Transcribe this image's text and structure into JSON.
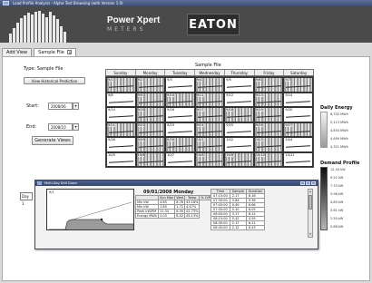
{
  "window": {
    "title": "Load Profile Analysis - Alpha Test Browsing (with Version 1.0)"
  },
  "banner": {
    "product_name": "Power Xpert",
    "product_sub": "METERS",
    "company": "EATON"
  },
  "tabs": [
    {
      "label": "Add View"
    },
    {
      "label": "Sample File",
      "close": "x"
    }
  ],
  "left_panel": {
    "type_label": "Type: Sample File",
    "view_historical_button": "View Historical Prediction",
    "start_label": "Start:",
    "start_value": "2008/06",
    "end_label": "End:",
    "end_value": "2008/10",
    "generate_button": "Generate Views",
    "days_value": "Day 1"
  },
  "calendar": {
    "title": "Sample File",
    "days": [
      "Sunday",
      "Monday",
      "Tuesday",
      "Wednesday",
      "Thursday",
      "Friday",
      "Saturday"
    ],
    "weeks": [
      [
        "9/1",
        "9/2",
        "9/3",
        "9/4",
        "9/5",
        "9/6",
        "9/7"
      ],
      [
        "9/8",
        "9/9",
        "9/10",
        "9/11",
        "9/12",
        "9/13",
        "9/14"
      ],
      [
        "9/14",
        "9/15",
        "9/16",
        "9/17",
        "9/18",
        "9/19",
        "9/20"
      ],
      [
        "9/21",
        "9/22",
        "9/23",
        "9/24",
        "9/25",
        "9/26",
        "9/27"
      ],
      [
        "9/28",
        "9/29",
        "9/30",
        "10/1",
        "10/2",
        "10/3",
        "10/4"
      ],
      [
        "10/5",
        "10/6",
        "10/7",
        "10/8",
        "10/9",
        "10/10",
        "10/11"
      ]
    ]
  },
  "legend_energy": {
    "title": "Daily Energy",
    "ticks": [
      "6,332 MWh",
      "5,113 MWh",
      "4,834 MWh",
      "4,659 MWh",
      "4,321 MWh"
    ]
  },
  "legend_demand": {
    "title": "Demand Profile",
    "ticks": [
      "12.34 kW",
      "9.52 kW",
      "7.33 kW",
      "5.96 kW",
      "4.89 kW",
      "3.61 kW",
      "2.50 kW",
      "0.88 kW"
    ]
  },
  "dialog": {
    "title": "Multi-Day Drill Down",
    "date_title": "09/01/2008 Monday",
    "chart_label": "9/1",
    "stats": {
      "headers": [
        "Sun Mon",
        "Wed",
        "Temp",
        "% O/P"
      ],
      "rows": [
        [
          "Min kW",
          "4.85",
          "8.76",
          "43.18%"
        ],
        [
          "Min kW",
          "1.80",
          "1.72",
          "4.47%"
        ],
        [
          "Peak kW/PM",
          "11.34",
          "8.59",
          "42.73%"
        ],
        [
          "Energy MWh",
          "2.03",
          "8.52",
          "45.13%"
        ]
      ]
    },
    "times": {
      "headers": [
        "Time",
        "Sample",
        "Duration"
      ],
      "rows": [
        [
          "07:15:00",
          "2.17",
          "6.16"
        ],
        [
          "07:30:00",
          "3.84",
          "5.36"
        ],
        [
          "07:45:00",
          "0.49",
          "6.66"
        ],
        [
          "07:50:00",
          "5.10",
          "6.05"
        ],
        [
          "08:00:00",
          "3.17",
          "6.12"
        ],
        [
          "08:15:00",
          "5.42",
          "4.59"
        ],
        [
          "08:30:00",
          "2.17",
          "6.11"
        ],
        [
          "08:45:00",
          "2.12",
          "6.43"
        ]
      ]
    }
  },
  "colors": {
    "titlebar": "#3c4d74",
    "banner": "#4a4a4a",
    "eaton_box": "#2d2d2d"
  }
}
